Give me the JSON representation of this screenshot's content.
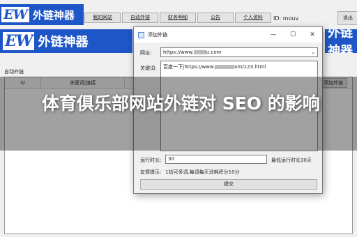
{
  "brand": {
    "mark": "EW",
    "name": "外链神器"
  },
  "tabs": [
    "我的网站",
    "自动外链",
    "财务明细",
    "公告",
    "个人资料"
  ],
  "user_id": "ID: mouv",
  "exit_label": "退出",
  "section_label": "自动外链",
  "grid": {
    "columns": [
      "id",
      "关键词|链接"
    ]
  },
  "add_link_label": "添加外链",
  "dialog": {
    "title": "添加外链",
    "controls": {
      "minimize": "—",
      "maximize": "☐",
      "close": "✕"
    },
    "url_label": "网址:",
    "url_value_prefix": "https://www.",
    "url_value_suffix": "u.com",
    "keyword_label": "关键词:",
    "keyword_prefix": "百度一下|https://www.",
    "keyword_suffix": "om/123.html",
    "run_label": "运行时长:",
    "run_value": "30",
    "run_hint": "最低运行时长30天",
    "tip_label": "友情提示:",
    "tip_text": "1站可多词,每词每天消耗积分10分",
    "submit_label": "提交"
  },
  "overlay_title": "体育俱乐部网站外链对 SEO 的影响"
}
